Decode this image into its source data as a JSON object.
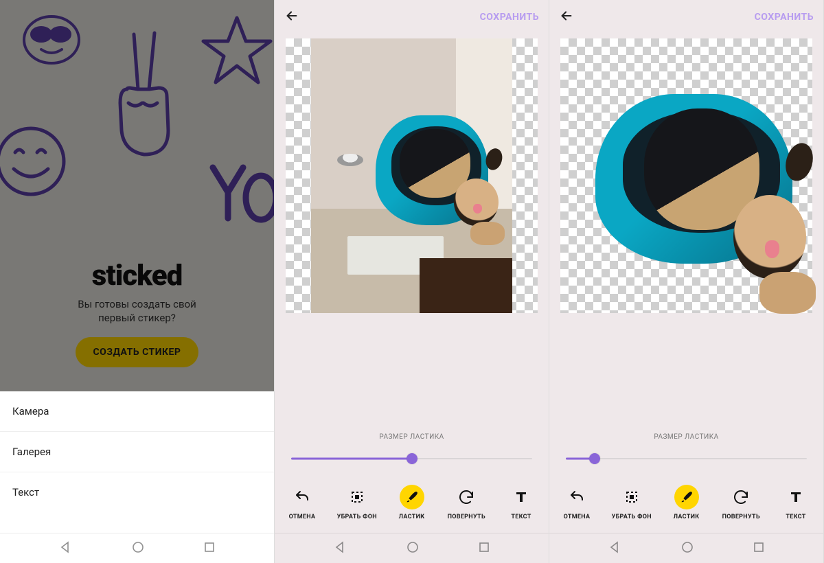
{
  "pane1": {
    "app_name": "sticked",
    "tagline_line1": "Вы готовы создать свой",
    "tagline_line2": "первый стикер?",
    "cta_label": "СОЗДАТЬ СТИКЕР",
    "sheet": {
      "items": [
        {
          "label": "Камера"
        },
        {
          "label": "Галерея"
        },
        {
          "label": "Текст"
        }
      ]
    },
    "doodles": [
      "sunglasses-face",
      "peace-hand",
      "star",
      "smile-face",
      "yo-text"
    ]
  },
  "editor": {
    "save_label": "СОХРАНИТЬ",
    "slider_label": "РАЗМЕР ЛАСТИКА",
    "tools": [
      {
        "icon": "undo",
        "label": "ОТМЕНА"
      },
      {
        "icon": "crop",
        "label": "УБРАТЬ ФОН"
      },
      {
        "icon": "brush",
        "label": "ЛАСТИК",
        "active": true
      },
      {
        "icon": "rotate",
        "label": "ПОВЕРНУТЬ"
      },
      {
        "icon": "text",
        "label": "ТЕКСТ"
      }
    ]
  },
  "pane2": {
    "slider_percent": 50,
    "image_has_background": true
  },
  "pane3": {
    "slider_percent": 12,
    "image_has_background": false
  },
  "colors": {
    "accent_purple": "#8a65d8",
    "cta_yellow": "#ffd500",
    "editor_bg": "#efe8ea"
  }
}
